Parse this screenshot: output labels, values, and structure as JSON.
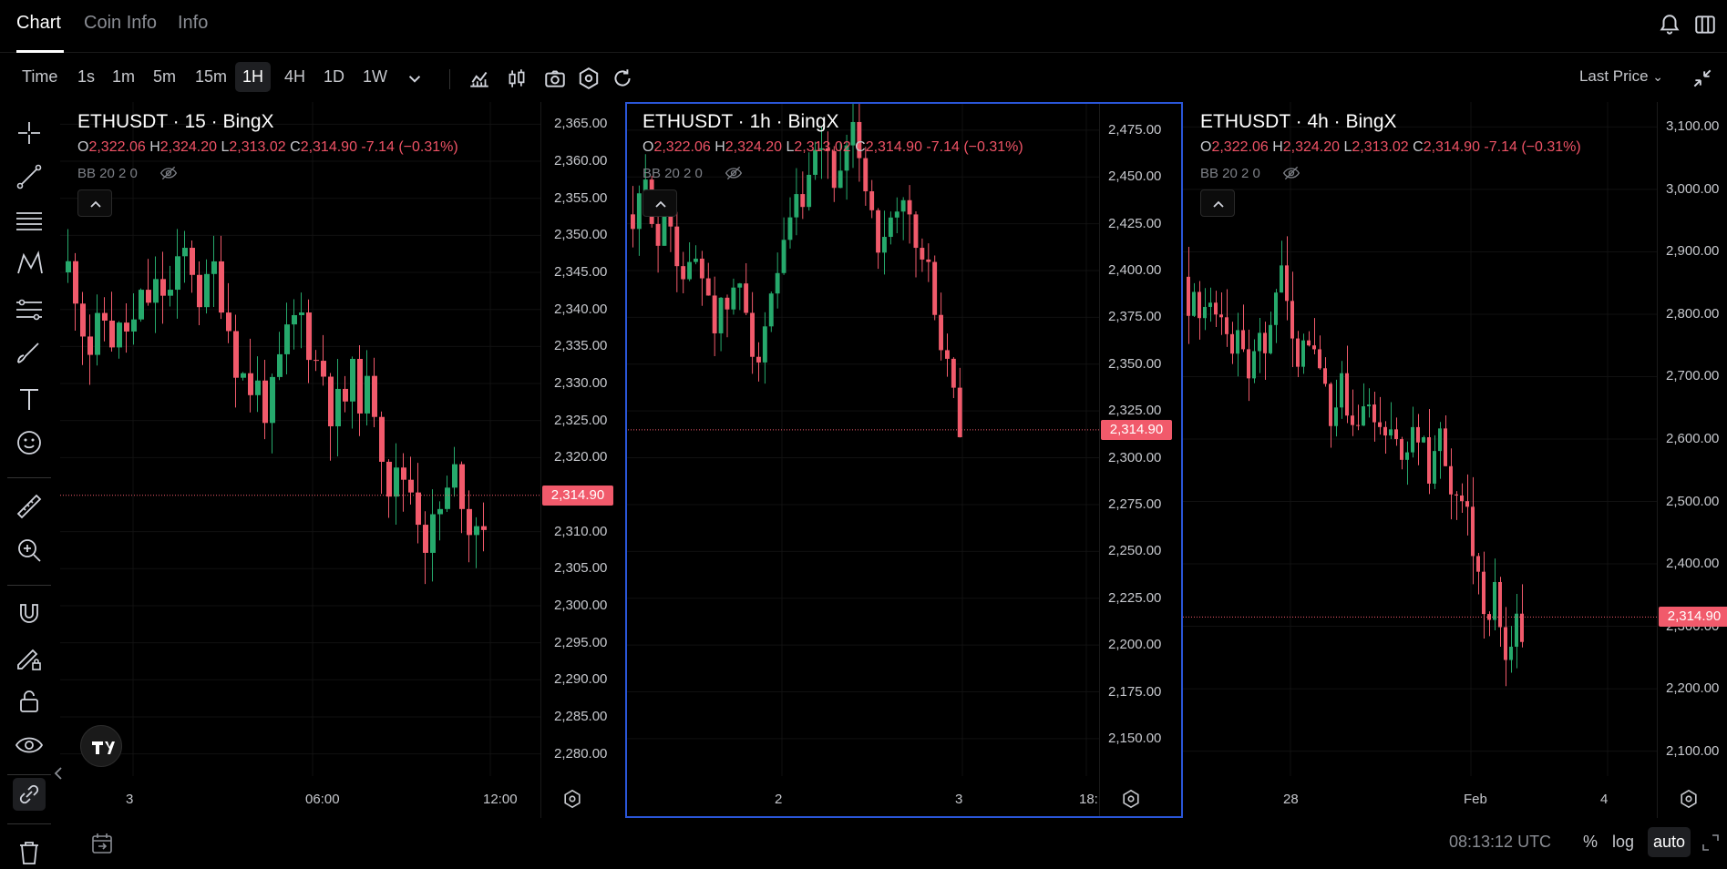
{
  "tabs": [
    {
      "label": "Chart"
    },
    {
      "label": "Coin Info"
    },
    {
      "label": "Info"
    }
  ],
  "toolbar": {
    "timeframes": [
      "Time",
      "1s",
      "1m",
      "5m",
      "15m",
      "1H",
      "4H",
      "1D",
      "1W"
    ],
    "active_timeframe": "1H",
    "price_type": "Last Price"
  },
  "panes": [
    {
      "title": "ETHUSDT · 15 · BingX",
      "ohlc": {
        "o": "2,322.06",
        "h": "2,324.20",
        "l": "2,313.02",
        "c": "2,314.90",
        "chg": "-7.14 (−0.31%)"
      },
      "indicator": "BB 20 2 0",
      "last_price": "2,314.90",
      "y_ticks": [
        "2,365.00",
        "2,360.00",
        "2,355.00",
        "2,350.00",
        "2,345.00",
        "2,340.00",
        "2,335.00",
        "2,330.00",
        "2,325.00",
        "2,320.00",
        "2,310.00",
        "2,305.00",
        "2,300.00",
        "2,295.00",
        "2,290.00",
        "2,285.00",
        "2,280.00"
      ],
      "y_range": [
        2277,
        2368
      ],
      "x_ticks": [
        "3",
        "06:00",
        "12:00"
      ]
    },
    {
      "title": "ETHUSDT · 1h · BingX",
      "ohlc": {
        "o": "2,322.06",
        "h": "2,324.20",
        "l": "2,313.02",
        "c": "2,314.90",
        "chg": "-7.14 (−0.31%)"
      },
      "indicator": "BB 20 2 0",
      "last_price": "2,314.90",
      "y_ticks": [
        "2,475.00",
        "2,450.00",
        "2,425.00",
        "2,400.00",
        "2,375.00",
        "2,350.00",
        "2,325.00",
        "2,300.00",
        "2,275.00",
        "2,250.00",
        "2,225.00",
        "2,200.00",
        "2,175.00",
        "2,150.00"
      ],
      "y_range": [
        2130,
        2490
      ],
      "x_ticks": [
        "2",
        "3",
        "18:"
      ]
    },
    {
      "title": "ETHUSDT · 4h · BingX",
      "ohlc": {
        "o": "2,322.06",
        "h": "2,324.20",
        "l": "2,313.02",
        "c": "2,314.90",
        "chg": "-7.14 (−0.31%)"
      },
      "indicator": "BB 20 2 0",
      "last_price": "2,314.90",
      "y_ticks": [
        "3,100.00",
        "3,000.00",
        "2,900.00",
        "2,800.00",
        "2,700.00",
        "2,600.00",
        "2,500.00",
        "2,400.00",
        "2,300.00",
        "2,200.00",
        "2,100.00"
      ],
      "y_range": [
        2060,
        3140
      ],
      "x_ticks": [
        "28",
        "Feb",
        "4"
      ]
    }
  ],
  "bottom": {
    "time": "08:13:12 UTC",
    "percent": "%",
    "log": "log",
    "auto": "auto"
  },
  "colors": {
    "up": "#26a96c",
    "down": "#f15a6b",
    "accent": "#2a56d8"
  }
}
